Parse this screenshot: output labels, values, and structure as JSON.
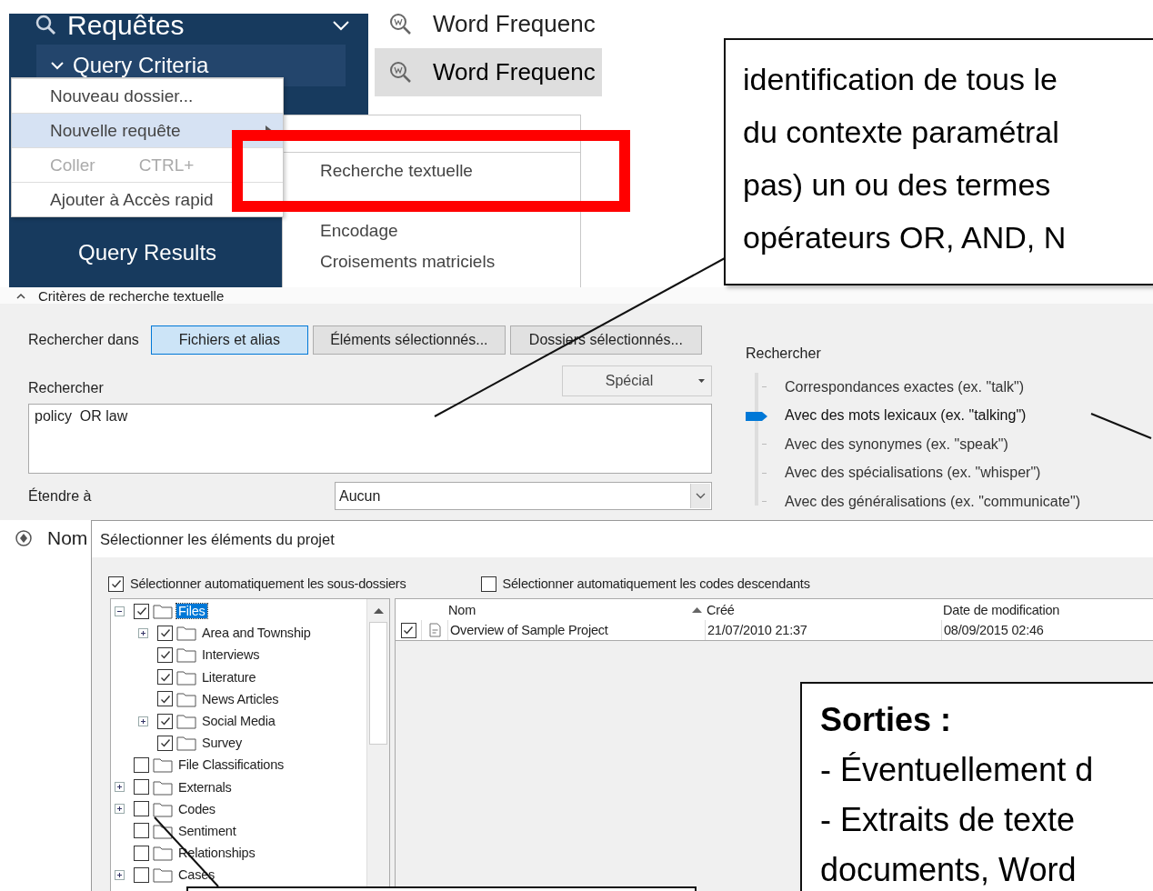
{
  "nav": {
    "title": "Requêtes",
    "items": [
      {
        "label": "Query Criteria",
        "selected": true
      },
      {
        "label": "Query Results",
        "selected": false
      }
    ]
  },
  "query_list": {
    "items": [
      {
        "label": "Word Frequenc",
        "selected": false
      },
      {
        "label": "Word Frequenc",
        "selected": true
      }
    ]
  },
  "context_menu": {
    "items": [
      {
        "label": "Nouveau dossier...",
        "selected": false,
        "disabled": false,
        "submenu": false
      },
      {
        "label": "Nouvelle requête",
        "selected": true,
        "disabled": false,
        "submenu": true
      },
      {
        "label": "Coller",
        "shortcut": "CTRL+",
        "selected": false,
        "disabled": true,
        "submenu": false
      },
      {
        "label": "Ajouter à Accès rapid",
        "selected": false,
        "disabled": false,
        "submenu": false
      }
    ]
  },
  "submenu": {
    "items": [
      "Recherche textuelle",
      "Encodage",
      "Croisements matriciels"
    ]
  },
  "criteria": {
    "title": "Critères de recherche textuelle",
    "search_in_label": "Rechercher dans",
    "scope_buttons": [
      {
        "label": "Fichiers et alias",
        "selected": true
      },
      {
        "label": "Éléments sélectionnés...",
        "selected": false
      },
      {
        "label": "Dossiers sélectionnés...",
        "selected": false
      }
    ],
    "search_label": "Rechercher",
    "special_button": "Spécial",
    "search_value": "policy  OR law",
    "extend_label": "Étendre à",
    "extend_value": "Aucun",
    "match_label": "Rechercher",
    "match_options": [
      {
        "label": "Correspondances exactes (ex. \"talk\")",
        "selected": false
      },
      {
        "label": "Avec des mots lexicaux (ex. \"talking\")",
        "selected": true
      },
      {
        "label": "Avec des synonymes (ex. \"speak\")",
        "selected": false
      },
      {
        "label": "Avec des spécialisations (ex. \"whisper\")",
        "selected": false
      },
      {
        "label": "Avec des généralisations (ex. \"communicate\")",
        "selected": false
      }
    ]
  },
  "results_column": {
    "label": "Nom"
  },
  "dialog": {
    "title": "Sélectionner les éléments du projet",
    "options": [
      {
        "label": "Sélectionner automatiquement les sous-dossiers",
        "checked": true
      },
      {
        "label": "Sélectionner automatiquement les codes descendants",
        "checked": false
      }
    ],
    "tree": [
      {
        "label": "Files",
        "checked": true,
        "selected": true,
        "expanded": true,
        "children": [
          {
            "label": "Area and Township",
            "checked": true,
            "selected": false,
            "expanded": false
          },
          {
            "label": "Interviews",
            "checked": true,
            "selected": false
          },
          {
            "label": "Literature",
            "checked": true,
            "selected": false
          },
          {
            "label": "News Articles",
            "checked": true,
            "selected": false
          },
          {
            "label": "Social Media",
            "checked": true,
            "selected": false,
            "expanded": false
          },
          {
            "label": "Survey",
            "checked": true,
            "selected": false
          }
        ]
      },
      {
        "label": "File Classifications",
        "checked": false,
        "selected": false
      },
      {
        "label": "Externals",
        "checked": false,
        "selected": false,
        "expanded": false
      },
      {
        "label": "Codes",
        "checked": false,
        "selected": false,
        "expanded": false
      },
      {
        "label": "Sentiment",
        "checked": false,
        "selected": false
      },
      {
        "label": "Relationships",
        "checked": false,
        "selected": false
      },
      {
        "label": "Cases",
        "checked": false,
        "selected": false,
        "expanded": false
      }
    ],
    "table": {
      "columns": [
        {
          "label": "Nom",
          "sorted": false
        },
        {
          "label": "Créé",
          "sorted": true
        },
        {
          "label": "Date de modification",
          "sorted": false
        }
      ],
      "rows": [
        {
          "checked": true,
          "cells": [
            "Overview of Sample Project",
            "21/07/2010 21:37",
            "08/09/2015 02:46"
          ]
        }
      ]
    }
  },
  "callouts": [
    {
      "kind": "plain",
      "lines": [
        "identification de tous le",
        "du contexte paramétral",
        "pas) un ou des termes",
        "opérateurs OR, AND, N"
      ]
    },
    {
      "kind": "titled",
      "title": "Sorties :",
      "lines": [
        "- Éventuellement d",
        "- Extraits de texte",
        "documents, Word"
      ]
    }
  ]
}
